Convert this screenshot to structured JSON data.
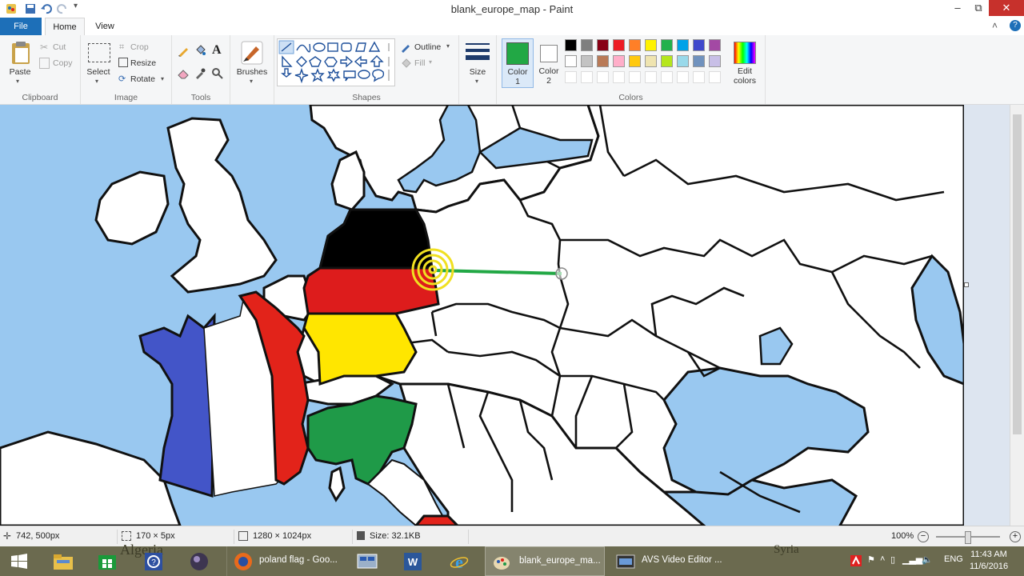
{
  "window": {
    "title": "blank_europe_map - Paint",
    "minimize": "–",
    "restore": "⧉",
    "close": "✕",
    "help": "?",
    "collapse": "˄"
  },
  "tabs": [
    "File",
    "Home",
    "View"
  ],
  "ribbon": {
    "clipboard": {
      "paste": "Paste",
      "cut": "Cut",
      "copy": "Copy",
      "label": "Clipboard"
    },
    "image": {
      "select": "Select",
      "crop": "Crop",
      "resize": "Resize",
      "rotate": "Rotate",
      "label": "Image"
    },
    "tools": {
      "label": "Tools",
      "text_tool": "A"
    },
    "brushes": {
      "label": "Brushes"
    },
    "shapes": {
      "outline": "Outline",
      "fill": "Fill",
      "label": "Shapes"
    },
    "size": {
      "label": "Size"
    },
    "colors": {
      "color1": "Color\n1",
      "color1_a": "Color",
      "color1_b": "1",
      "color2_a": "Color",
      "color2_b": "2",
      "edit_a": "Edit",
      "edit_b": "colors",
      "label": "Colors",
      "color1_value": "#22a845",
      "color2_value": "#ffffff",
      "palette_row1": [
        "#000000",
        "#7f7f7f",
        "#880015",
        "#ed1c24",
        "#ff7f27",
        "#fff200",
        "#22b14c",
        "#00a2e8",
        "#3f48cc",
        "#a349a4"
      ],
      "palette_row2": [
        "#ffffff",
        "#c3c3c3",
        "#b97a57",
        "#ffaec9",
        "#ffc90e",
        "#efe4b0",
        "#b5e61d",
        "#99d9ea",
        "#7092be",
        "#c8bfe7"
      ]
    }
  },
  "statusbar": {
    "cursor_pos": "742, 500px",
    "selection_size": "170 × 5px",
    "image_size": "1280 × 1024px",
    "file_size": "Size: 32.1KB",
    "zoom": "100%"
  },
  "map_labels": {
    "algeria": "Algeria",
    "syria": "Syria"
  },
  "taskbar": {
    "items": [
      {
        "name": "start",
        "label": ""
      },
      {
        "name": "file-explorer",
        "label": ""
      },
      {
        "name": "store",
        "label": ""
      },
      {
        "name": "help",
        "label": ""
      },
      {
        "name": "app-orb",
        "label": ""
      },
      {
        "name": "firefox",
        "label": "poland flag - Goo..."
      },
      {
        "name": "network-app",
        "label": ""
      },
      {
        "name": "word",
        "label": ""
      },
      {
        "name": "ie",
        "label": ""
      },
      {
        "name": "paint",
        "label": "blank_europe_ma..."
      },
      {
        "name": "avs",
        "label": "AVS Video Editor ..."
      }
    ],
    "lang": "ENG",
    "time": "11:43 AM",
    "date": "11/6/2016"
  },
  "colors": {
    "accent": "#1d6fb8",
    "sea": "#99c8f0",
    "land": "#ffffff",
    "germany": [
      "#000000",
      "#dd1c1c",
      "#ffe600"
    ],
    "france": [
      "#4355c8",
      "#ffffff",
      "#e2231a"
    ],
    "italy": [
      "#1f9a48",
      "#ffffff",
      "#e2231a"
    ],
    "stroke": "#22a845",
    "highlight": "#f0e020"
  }
}
